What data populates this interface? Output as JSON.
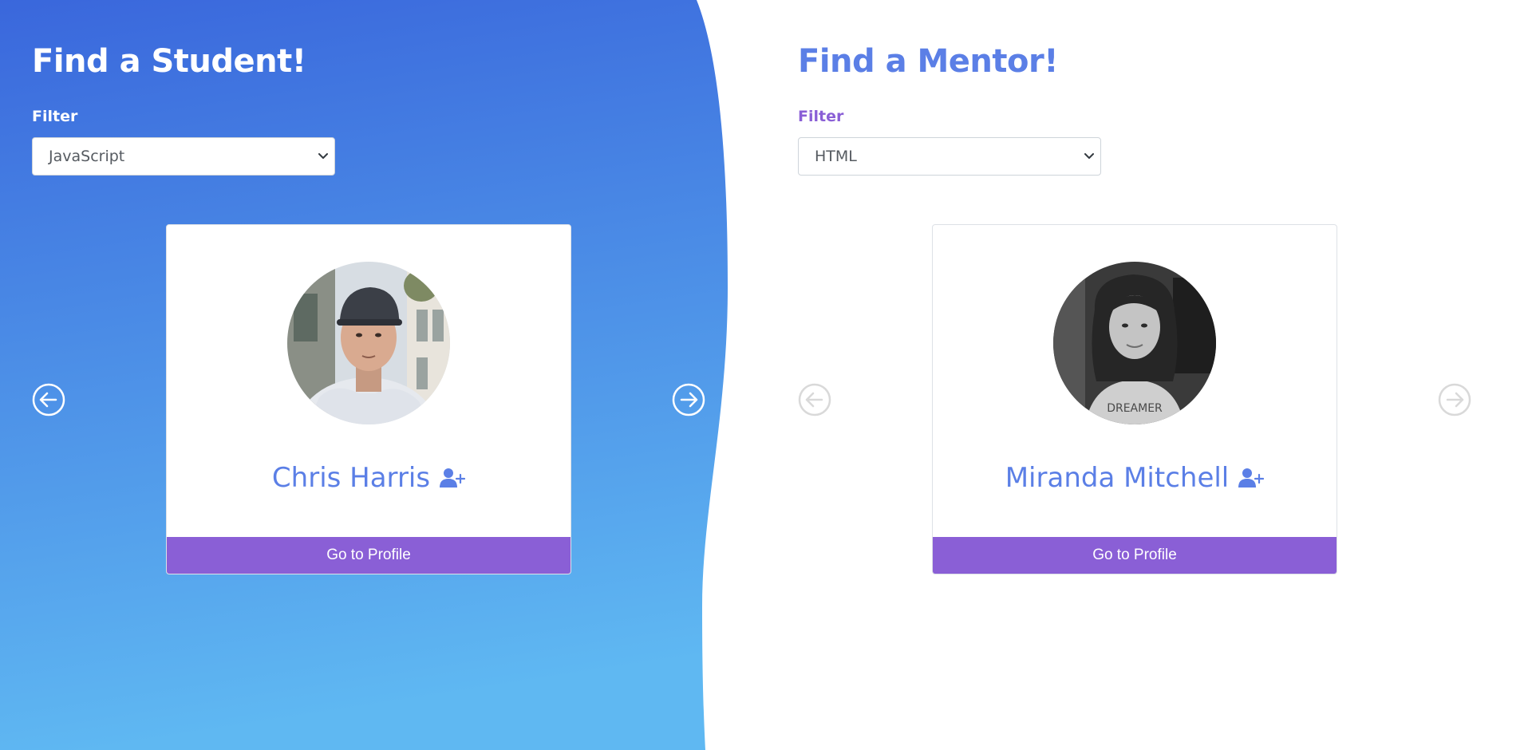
{
  "student_section": {
    "title": "Find a Student!",
    "filter_label": "Filter",
    "filter_value": "JavaScript",
    "card": {
      "name": "Chris Harris",
      "button_label": "Go to Profile",
      "avatar_icon": "avatar-photo-man-cap"
    },
    "prev_icon": "arrow-left-circle-icon",
    "next_icon": "arrow-right-circle-icon"
  },
  "mentor_section": {
    "title": "Find a Mentor!",
    "filter_label": "Filter",
    "filter_value": "HTML",
    "card": {
      "name": "Miranda Mitchell",
      "button_label": "Go to Profile",
      "avatar_icon": "avatar-photo-woman-bw"
    },
    "prev_icon": "arrow-left-circle-icon",
    "next_icon": "arrow-right-circle-icon"
  },
  "colors": {
    "gradient_top": "#3a67dc",
    "gradient_bottom": "#5fb8f2",
    "accent_blue": "#5b7fe6",
    "accent_purple": "#8a5fd6",
    "disabled_arrow": "#d9d9d9"
  }
}
